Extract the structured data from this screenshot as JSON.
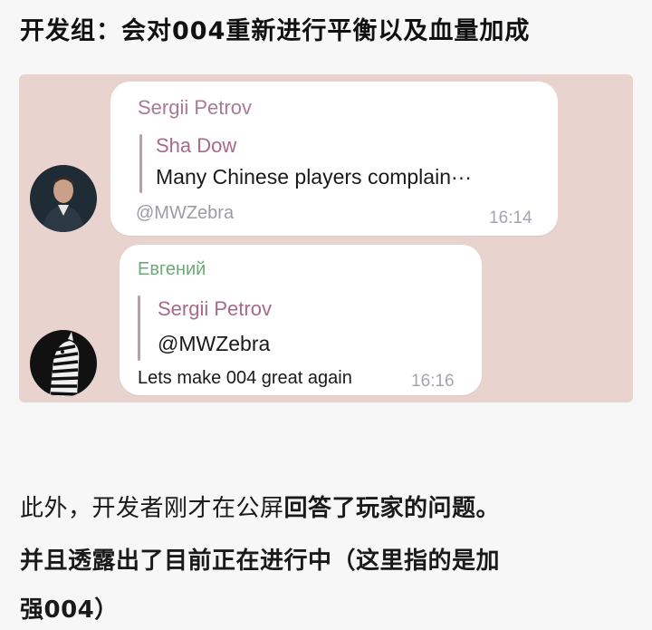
{
  "heading": "开发组：会对004重新进行平衡以及血量加成",
  "chat": {
    "colors": {
      "background": "#e9d3ce",
      "bubble": "#ffffff",
      "quote_name": "#a8698a",
      "sender_1": "#a97a96",
      "sender_2": "#6da97a"
    },
    "messages": [
      {
        "sender": "Sergii Petrov",
        "reply_to_name": "Sha Dow",
        "reply_to_text": "Many Chinese players complain···",
        "text": "@MWZebra",
        "time": "16:14",
        "avatar_icon": "person-photo-avatar"
      },
      {
        "sender": "Евгений",
        "reply_to_name": "Sergii Petrov",
        "reply_to_text": "@MWZebra",
        "text": "Lets make 004 great again",
        "time": "16:16",
        "avatar_icon": "zebra-avatar"
      }
    ]
  },
  "paragraph": {
    "line1_normal": "此外，开发者刚才在公屏",
    "line1_bold": "回答了玩家的问题。",
    "line2": "并且透露出了目前正在进行中（这里指的是加",
    "line3": "强004）"
  }
}
